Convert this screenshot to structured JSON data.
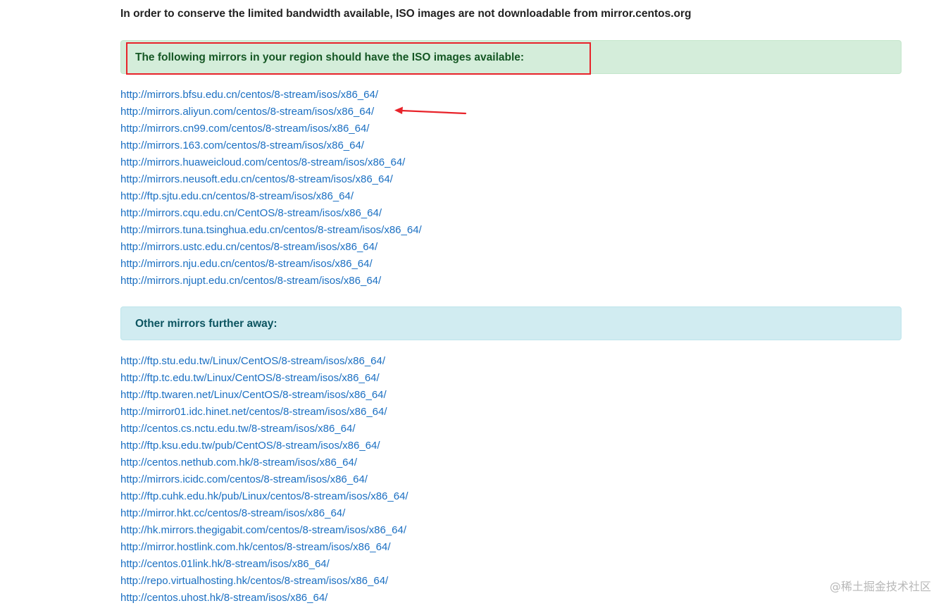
{
  "intro_text": "In order to conserve the limited bandwidth available, ISO images are not downloadable from mirror.centos.org",
  "regional_section": {
    "heading": "The following mirrors in your region should have the ISO images available:",
    "links": [
      "http://mirrors.bfsu.edu.cn/centos/8-stream/isos/x86_64/",
      "http://mirrors.aliyun.com/centos/8-stream/isos/x86_64/",
      "http://mirrors.cn99.com/centos/8-stream/isos/x86_64/",
      "http://mirrors.163.com/centos/8-stream/isos/x86_64/",
      "http://mirrors.huaweicloud.com/centos/8-stream/isos/x86_64/",
      "http://mirrors.neusoft.edu.cn/centos/8-stream/isos/x86_64/",
      "http://ftp.sjtu.edu.cn/centos/8-stream/isos/x86_64/",
      "http://mirrors.cqu.edu.cn/CentOS/8-stream/isos/x86_64/",
      "http://mirrors.tuna.tsinghua.edu.cn/centos/8-stream/isos/x86_64/",
      "http://mirrors.ustc.edu.cn/centos/8-stream/isos/x86_64/",
      "http://mirrors.nju.edu.cn/centos/8-stream/isos/x86_64/",
      "http://mirrors.njupt.edu.cn/centos/8-stream/isos/x86_64/"
    ]
  },
  "other_section": {
    "heading": "Other mirrors further away:",
    "links": [
      "http://ftp.stu.edu.tw/Linux/CentOS/8-stream/isos/x86_64/",
      "http://ftp.tc.edu.tw/Linux/CentOS/8-stream/isos/x86_64/",
      "http://ftp.twaren.net/Linux/CentOS/8-stream/isos/x86_64/",
      "http://mirror01.idc.hinet.net/centos/8-stream/isos/x86_64/",
      "http://centos.cs.nctu.edu.tw/8-stream/isos/x86_64/",
      "http://ftp.ksu.edu.tw/pub/CentOS/8-stream/isos/x86_64/",
      "http://centos.nethub.com.hk/8-stream/isos/x86_64/",
      "http://mirrors.icidc.com/centos/8-stream/isos/x86_64/",
      "http://ftp.cuhk.edu.hk/pub/Linux/centos/8-stream/isos/x86_64/",
      "http://mirror.hkt.cc/centos/8-stream/isos/x86_64/",
      "http://hk.mirrors.thegigabit.com/centos/8-stream/isos/x86_64/",
      "http://mirror.hostlink.com.hk/centos/8-stream/isos/x86_64/",
      "http://centos.01link.hk/8-stream/isos/x86_64/",
      "http://repo.virtualhosting.hk/centos/8-stream/isos/x86_64/",
      "http://centos.uhost.hk/8-stream/isos/x86_64/"
    ]
  },
  "annotations": {
    "highlight_color": "#e8232a",
    "arrow_color": "#e8232a",
    "arrow_icon": "red-arrow-pointing-left"
  },
  "watermark": "@稀土掘金技术社区",
  "colors": {
    "link": "#1a6fc2",
    "success_bg": "#d4edda",
    "success_text": "#155724",
    "info_bg": "#d1ecf1",
    "info_text": "#0c5460"
  }
}
